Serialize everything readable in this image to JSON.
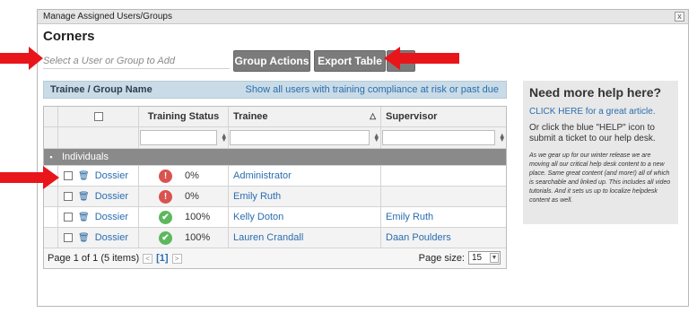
{
  "window": {
    "title": "Manage Assigned Users/Groups",
    "close_label": "x"
  },
  "heading": "Corners",
  "user_search": {
    "placeholder": "Select a User or Group to Add"
  },
  "toolbar": {
    "group_actions_label": "Group Actions",
    "export_table_label": "Export Table"
  },
  "grid_header": {
    "title": "Trainee / Group Name",
    "link": "Show all users with training compliance at risk or past due"
  },
  "columns": {
    "training_status": "Training Status",
    "trainee": "Trainee",
    "supervisor": "Supervisor",
    "sort_indicator": "△",
    "filter_icon": "⧫"
  },
  "group": {
    "toggle": "▪",
    "label": "Individuals"
  },
  "rows": [
    {
      "name": "Dossier",
      "status": "bad",
      "status_icon": "!",
      "percent": "0%",
      "trainee": "Administrator",
      "supervisor": ""
    },
    {
      "name": "Dossier",
      "status": "bad",
      "status_icon": "!",
      "percent": "0%",
      "trainee": "Emily Ruth",
      "supervisor": ""
    },
    {
      "name": "Dossier",
      "status": "good",
      "status_icon": "✔",
      "percent": "100%",
      "trainee": "Kelly Doton",
      "supervisor": "Emily Ruth"
    },
    {
      "name": "Dossier",
      "status": "good",
      "status_icon": "✔",
      "percent": "100%",
      "trainee": "Lauren Crandall",
      "supervisor": "Daan Poulders"
    }
  ],
  "pager": {
    "summary": "Page 1 of 1 (5 items)",
    "prev": "<",
    "current": "[1]",
    "next": ">",
    "page_size_label": "Page size:",
    "page_size_value": "15"
  },
  "help": {
    "title": "Need more help here?",
    "link": "CLICK HERE for a great article.",
    "text": "Or click the blue \"HELP\" icon to submit a ticket to our help desk.",
    "note": "As we gear up for our winter release we are moving all our critical help desk content to a new place.  Same great content (and more!) all of which is searchable and linked up.  This includes all video tutorials.  And it sets us up to localize helpdesk content as well."
  },
  "colors": {
    "annotation_arrow": "#e8161b",
    "button_bg": "#7b7b7b",
    "group_bar": "#8a8a8a",
    "header_band": "#c9dbe6",
    "status_bad": "#d9534f",
    "status_good": "#5cb85c"
  }
}
